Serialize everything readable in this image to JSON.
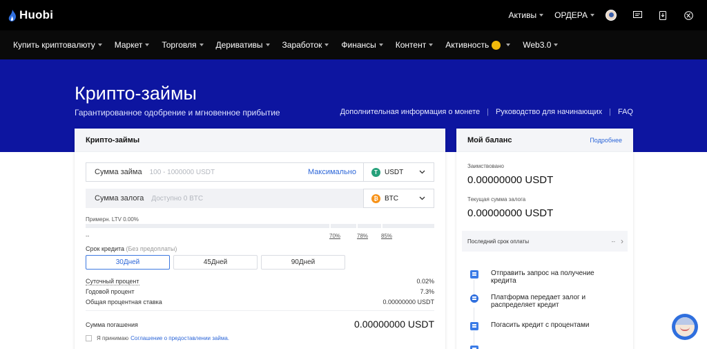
{
  "topbar": {
    "logo": "Huobi",
    "assets": "Активы",
    "orders": "ОРДЕРА"
  },
  "nav": {
    "items": [
      {
        "label": "Купить криптовалюту",
        "dropdown": true
      },
      {
        "label": "Маркет",
        "dropdown": true
      },
      {
        "label": "Торговля",
        "dropdown": true
      },
      {
        "label": "Деривативы",
        "dropdown": true
      },
      {
        "label": "Заработок",
        "dropdown": true
      },
      {
        "label": "Финансы",
        "dropdown": true
      },
      {
        "label": "Контент",
        "dropdown": true
      },
      {
        "label": "Активность",
        "dropdown": true,
        "badge_icon": "coin-icon"
      },
      {
        "label": "Web3.0",
        "dropdown": true
      }
    ]
  },
  "hero": {
    "title": "Крипто-займы",
    "subtitle": "Гарантированное одобрение и мгновенное прибытие",
    "links": [
      "Дополнительная информация о монете",
      "Руководство для начинающих",
      "FAQ"
    ],
    "separator": "|"
  },
  "loan": {
    "header": "Крипто-займы",
    "loan_amount": {
      "label": "Сумма займа",
      "placeholder": "100 - 1000000 USDT",
      "max": "Максимально",
      "currency": "USDT"
    },
    "collateral": {
      "label": "Сумма залога",
      "placeholder": "Доступно 0 BTC",
      "currency": "BTC"
    },
    "ltv": {
      "label": "Примерн. LTV 0.00%",
      "value_placeholder": "--",
      "marks": [
        "70%",
        "78%",
        "85%"
      ]
    },
    "term": {
      "label": "Срок кредита",
      "label_note": "(Без предоплаты)",
      "options": [
        "30Дней",
        "45Дней",
        "90Дней"
      ],
      "selected": "30Дней"
    },
    "rates": [
      {
        "label": "Суточный процент",
        "value": "0.02%"
      },
      {
        "label": "Годовой процент",
        "value": "7.3%"
      },
      {
        "label": "Общая процентная ставка",
        "value": "0.00000000 USDT"
      }
    ],
    "repayment": {
      "label": "Сумма погашения",
      "value": "0.00000000 USDT"
    },
    "agreement": {
      "text": "Я принимаю",
      "link": "Соглашение о предоставлении займа."
    }
  },
  "balance": {
    "header": "Мой баланс",
    "more": "Подробнее",
    "borrowed_label": "Заимствовано",
    "borrowed_value": "0.00000000 USDT",
    "collateral_label": "Текущая сумма залога",
    "collateral_value": "0.00000000 USDT",
    "last_due_label": "Последний срок оплаты",
    "last_due_value": "--",
    "steps": [
      "Отправить запрос на получение кредита",
      "Платформа передает залог и распределяет кредит",
      "Погасить кредит с процентами"
    ]
  },
  "colors": {
    "hero_bg": "#0d15a0",
    "accent": "#2c66d8",
    "usdt": "#26a17b",
    "btc": "#f7931a"
  }
}
